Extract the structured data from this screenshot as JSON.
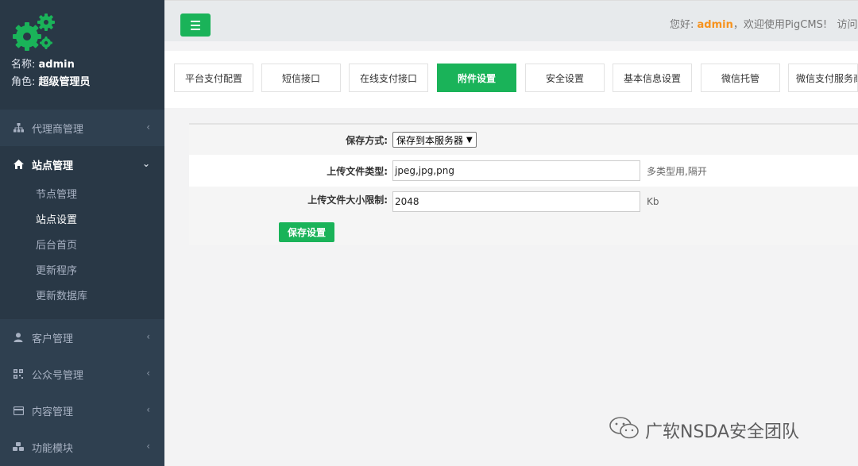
{
  "profile": {
    "name_label": "名称:",
    "name_value": "admin",
    "role_label": "角色:",
    "role_value": "超级管理员"
  },
  "sidebar": {
    "items": [
      {
        "label": "代理商管理",
        "icon": "sitemap-icon"
      },
      {
        "label": "站点管理",
        "icon": "home-icon"
      },
      {
        "label": "客户管理",
        "icon": "user-icon"
      },
      {
        "label": "公众号管理",
        "icon": "qrcode-icon"
      },
      {
        "label": "内容管理",
        "icon": "card-icon"
      },
      {
        "label": "功能模块",
        "icon": "cubes-icon"
      }
    ],
    "submenu": [
      {
        "label": "节点管理"
      },
      {
        "label": "站点设置"
      },
      {
        "label": "后台首页"
      },
      {
        "label": "更新程序"
      },
      {
        "label": "更新数据库"
      }
    ]
  },
  "header": {
    "greeting": "您好: ",
    "username": "admin",
    "welcome_text": "，欢迎使用PigCMS!",
    "visit_text": "访问"
  },
  "tabs": [
    {
      "label": "平台支付配置"
    },
    {
      "label": "短信接口"
    },
    {
      "label": "在线支付接口"
    },
    {
      "label": "附件设置"
    },
    {
      "label": "安全设置"
    },
    {
      "label": "基本信息设置"
    },
    {
      "label": "微信托管"
    },
    {
      "label": "微信支付服务商"
    }
  ],
  "form": {
    "storage_label": "保存方式:",
    "storage_value": "保存到本服务器",
    "filetype_label": "上传文件类型:",
    "filetype_value": "jpeg,jpg,png",
    "filetype_hint": "多类型用,隔开",
    "filesize_label": "上传文件大小限制:",
    "filesize_value": "2048",
    "filesize_unit": "Kb",
    "save_label": "保存设置"
  },
  "watermark": {
    "text": "广软NSDA安全团队"
  },
  "colors": {
    "accent": "#1ab359",
    "sidebar_bg": "#2f4050",
    "username": "#f7931e"
  }
}
